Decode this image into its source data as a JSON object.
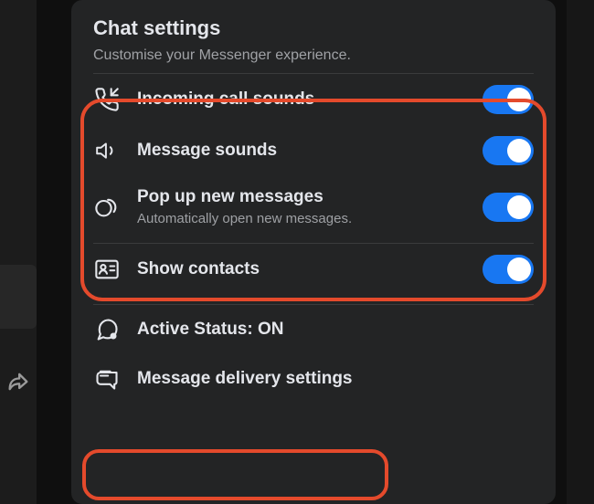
{
  "header": {
    "title": "Chat settings",
    "subtitle": "Customise your Messenger experience."
  },
  "rows": {
    "incoming_call_sounds": {
      "label": "Incoming call sounds"
    },
    "message_sounds": {
      "label": "Message sounds"
    },
    "popup": {
      "label": "Pop up new messages",
      "sub": "Automatically open new messages."
    },
    "show_contacts": {
      "label": "Show contacts"
    },
    "active_status": {
      "label": "Active Status: ON"
    },
    "delivery": {
      "label": "Message delivery settings"
    }
  }
}
